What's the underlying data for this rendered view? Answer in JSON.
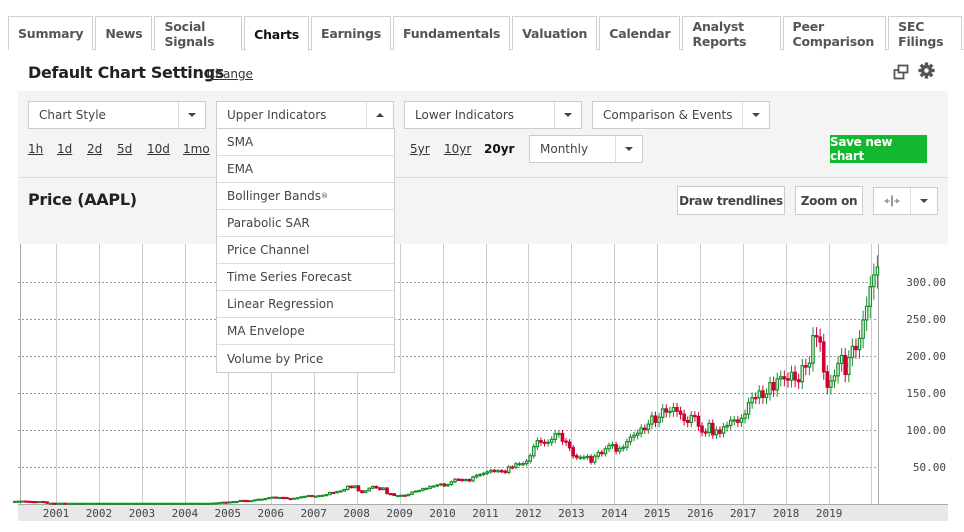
{
  "tabs": [
    {
      "label": "Summary",
      "active": false
    },
    {
      "label": "News",
      "active": false
    },
    {
      "label": "Social Signals",
      "active": false
    },
    {
      "label": "Charts",
      "active": true
    },
    {
      "label": "Earnings",
      "active": false
    },
    {
      "label": "Fundamentals",
      "active": false
    },
    {
      "label": "Valuation",
      "active": false
    },
    {
      "label": "Calendar",
      "active": false
    },
    {
      "label": "Analyst Reports",
      "active": false
    },
    {
      "label": "Peer Comparison",
      "active": false
    },
    {
      "label": "SEC Filings",
      "active": false
    }
  ],
  "header": {
    "title": "Default Chart Settings",
    "change_label": "Change",
    "popout_icon": "popout-window-icon",
    "settings_icon": "gear-icon"
  },
  "controls": {
    "chart_style": "Chart Style",
    "upper_indicators": "Upper Indicators",
    "lower_indicators": "Lower Indicators",
    "comparison_events": "Comparison & Events",
    "ranges": [
      {
        "label": "1h",
        "active": false
      },
      {
        "label": "1d",
        "active": false
      },
      {
        "label": "2d",
        "active": false
      },
      {
        "label": "5d",
        "active": false
      },
      {
        "label": "10d",
        "active": false
      },
      {
        "label": "1mo",
        "active": false
      },
      {
        "label": "5yr",
        "active": false
      },
      {
        "label": "10yr",
        "active": false
      },
      {
        "label": "20yr",
        "active": true
      }
    ],
    "interval": "Monthly",
    "save_label": "Save new chart",
    "save_color": "#12b82e"
  },
  "upper_indicator_menu": {
    "open": true,
    "items": [
      "SMA",
      "EMA",
      "Bollinger Bands",
      "Parabolic SAR",
      "Price Channel",
      "Time Series Forecast",
      "Linear Regression",
      "MA Envelope",
      "Volume by Price"
    ],
    "registered_mark_item": "Bollinger Bands",
    "registered_mark": "®"
  },
  "price_panel": {
    "title": "Price (AAPL)",
    "draw_trendlines_label": "Draw trendlines",
    "zoom_label": "Zoom on",
    "crosshair_icon": "crosshair-icon",
    "more_icon": "chevron-down-icon"
  },
  "chart_data": {
    "type": "candlestick",
    "title": "Price (AAPL)",
    "interval": "Monthly",
    "ylim": [
      0,
      350
    ],
    "yticks": [
      50,
      100,
      150,
      200,
      250,
      300
    ],
    "ytick_labels": [
      "50.00",
      "100.00",
      "150.00",
      "200.00",
      "250.00",
      "300.00"
    ],
    "xlim": [
      2000.1,
      2020.2
    ],
    "xticks": [
      2001,
      2002,
      2003,
      2004,
      2005,
      2006,
      2007,
      2008,
      2009,
      2010,
      2011,
      2012,
      2013,
      2014,
      2015,
      2016,
      2017,
      2018,
      2019
    ],
    "xtick_labels": [
      "2001",
      "2002",
      "2003",
      "2004",
      "2005",
      "2006",
      "2007",
      "2008",
      "2009",
      "2010",
      "2011",
      "2012",
      "2013",
      "2014",
      "2015",
      "2016",
      "2017",
      "2018",
      "2019"
    ],
    "grid": true,
    "up_color": "#1a8c2a",
    "down_color": "#cc0033",
    "yaxis_position": "right",
    "closes_by_year": {
      "2000": [
        3.5,
        3.8,
        3.9,
        3.6,
        3.3,
        3.2,
        3.0,
        3.3,
        2.9,
        1.0,
        1.0,
        0.9
      ],
      "2001": [
        1.0,
        1.0,
        0.9,
        0.9,
        0.9,
        0.9,
        0.9,
        0.9,
        0.9,
        0.9,
        0.9,
        0.9
      ],
      "2002": [
        0.9,
        0.9,
        0.9,
        0.9,
        0.9,
        0.9,
        0.9,
        0.9,
        0.9,
        0.9,
        0.9,
        0.9
      ],
      "2003": [
        0.9,
        0.9,
        0.9,
        0.9,
        0.9,
        0.9,
        0.9,
        0.9,
        0.9,
        0.9,
        0.9,
        0.9
      ],
      "2004": [
        0.9,
        0.9,
        0.9,
        0.9,
        0.9,
        0.9,
        0.9,
        1.1,
        1.3,
        1.8,
        2.4,
        2.3
      ],
      "2005": [
        2.8,
        3.2,
        3.3,
        4.8,
        4.7,
        4.2,
        4.5,
        5.5,
        6.4,
        6.5,
        7.3,
        8.6
      ],
      "2006": [
        9.3,
        8.7,
        8.8,
        8.7,
        7.4,
        7.3,
        7.7,
        8.4,
        9.7,
        10.3,
        11.4,
        10.6
      ],
      "2007": [
        10.6,
        11.3,
        11.7,
        12.6,
        15.6,
        15.2,
        16.9,
        17.6,
        19.6,
        24.0,
        22.2,
        24.4
      ],
      "2008": [
        17.9,
        15.5,
        17.9,
        21.3,
        23.7,
        21.9,
        19.5,
        21.6,
        14.0,
        13.9,
        11.5,
        11.5
      ],
      "2009": [
        11.8,
        11.3,
        13.1,
        16.2,
        17.5,
        18.2,
        20.9,
        21.1,
        23.8,
        24.2,
        25.7,
        27.0
      ],
      "2010": [
        24.6,
        26.3,
        30.0,
        33.4,
        33.0,
        32.2,
        33.0,
        31.3,
        36.5,
        38.8,
        39.9,
        41.5
      ],
      "2011": [
        43.4,
        45.4,
        44.7,
        45.0,
        44.3,
        42.7,
        50.0,
        49.7,
        54.3,
        54.4,
        54.6,
        57.9
      ],
      "2012": [
        65.2,
        77.5,
        85.7,
        83.4,
        82.5,
        83.4,
        87.3,
        95.0,
        95.3,
        85.0,
        83.6,
        76.0
      ],
      "2013": [
        65.1,
        63.1,
        63.2,
        63.3,
        64.2,
        56.6,
        64.6,
        69.6,
        68.1,
        74.7,
        79.2,
        80.1
      ],
      "2014": [
        71.5,
        75.2,
        76.7,
        84.3,
        90.4,
        92.9,
        95.6,
        102.5,
        100.8,
        108.0,
        118.9,
        110.4
      ],
      "2015": [
        117.2,
        128.5,
        124.4,
        125.2,
        130.3,
        125.4,
        121.3,
        112.8,
        110.3,
        119.5,
        118.3,
        105.3
      ],
      "2016": [
        97.3,
        96.7,
        108.9,
        93.7,
        99.9,
        95.6,
        104.2,
        106.1,
        113.1,
        113.5,
        110.5,
        115.8
      ],
      "2017": [
        121.4,
        136.9,
        143.7,
        143.6,
        152.8,
        144.0,
        148.7,
        164.0,
        154.1,
        169.0,
        171.9,
        169.2
      ],
      "2018": [
        167.4,
        178.1,
        167.8,
        165.3,
        186.9,
        185.1,
        190.3,
        227.6,
        225.7,
        218.9,
        178.6,
        157.7
      ],
      "2019": [
        166.4,
        173.2,
        190.0,
        200.7,
        175.1,
        197.9,
        213.0,
        208.7,
        223.9,
        248.8,
        267.1,
        293.7
      ],
      "2020": [
        309.5,
        320.0
      ]
    }
  }
}
